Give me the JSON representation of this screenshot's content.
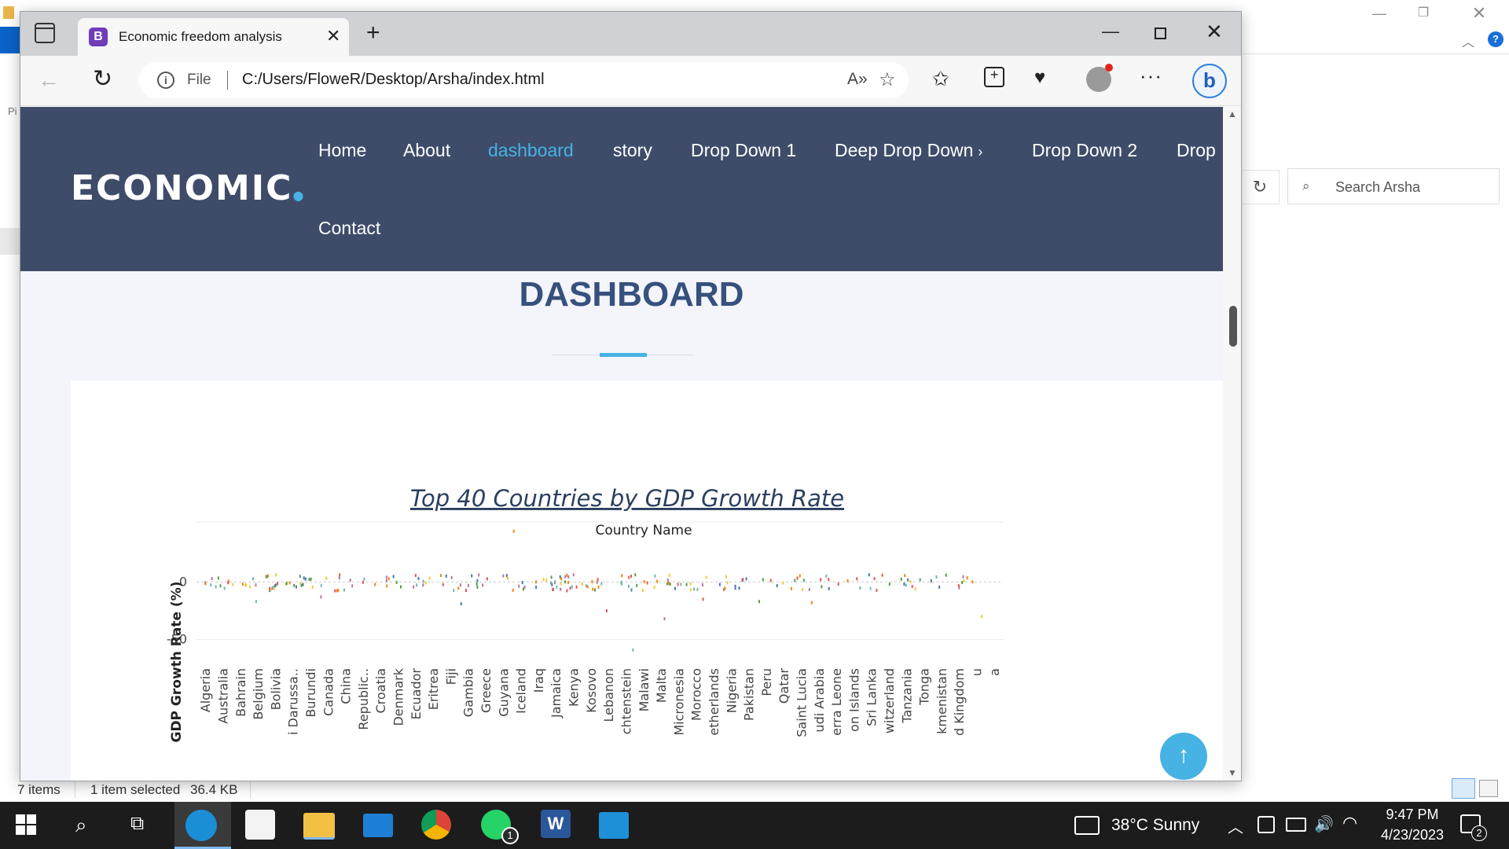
{
  "browser": {
    "tab_title": "Economic freedom analysis",
    "tab_favicon_letter": "B",
    "address_scheme": "File",
    "url": "C:/Users/FloweR/Desktop/Arsha/index.html"
  },
  "site": {
    "logo": "ECONOMIC",
    "nav": [
      {
        "label": "Home"
      },
      {
        "label": "About"
      },
      {
        "label": "dashboard",
        "active": true
      },
      {
        "label": "story"
      },
      {
        "label": "Drop Down 1"
      },
      {
        "label": "Deep Drop Down"
      },
      {
        "label": "Drop Down 2"
      },
      {
        "label": "Drop"
      },
      {
        "label": "Contact"
      }
    ],
    "section_title": "DASHBOARD"
  },
  "chart_data": {
    "type": "scatter",
    "title": "Top 40 Countries by GDP Growth Rate",
    "xlabel": "Country Name",
    "ylabel": "GDP Growth Rate (%)",
    "yticks": [
      "0",
      "-50"
    ],
    "ylim": [
      -68,
      52
    ],
    "grid": true,
    "x_tick_labels": [
      "Algeria",
      "Australia",
      "Bahrain",
      "Belgium",
      "Bolivia",
      "i Darussa..",
      "Burundi",
      "Canada",
      "China",
      "Republic..",
      "Croatia",
      "Denmark",
      "Ecuador",
      "Eritrea",
      "Fiji",
      "Gambia",
      "Greece",
      "Guyana",
      "Iceland",
      "Iraq",
      "Jamaica",
      "Kenya",
      "Kosovo",
      "Lebanon",
      "chtenstein",
      "Malawi",
      "Malta",
      "Micronesia",
      "Morocco",
      "etherlands",
      "Nigeria",
      "Pakistan",
      "Peru",
      "Qatar",
      "Saint Lucia",
      "udi Arabia",
      "erra Leone",
      "on Islands",
      "Sri Lanka",
      "witzerland",
      "Tanzania",
      "Tonga",
      "kmenistan",
      "d Kingdom",
      "u",
      "a"
    ],
    "notable_points": [
      {
        "x_index": 17.6,
        "y": 44
      },
      {
        "x_index": 24.4,
        "y": -59
      },
      {
        "x_index": 26.2,
        "y": -32
      },
      {
        "x_index": 22.9,
        "y": -25
      },
      {
        "x_index": 44.3,
        "y": -30
      },
      {
        "x_index": 14.6,
        "y": -19
      },
      {
        "x_index": 31.6,
        "y": -17
      },
      {
        "x_index": 34.6,
        "y": -18
      },
      {
        "x_index": 2.9,
        "y": -17
      },
      {
        "x_index": 6.6,
        "y": -13
      },
      {
        "x_index": 28.4,
        "y": -15
      }
    ],
    "series_colors": [
      "#f58518",
      "#4c78a8",
      "#e45756",
      "#72b7b2",
      "#54a24b",
      "#eeca3b",
      "#b279a2"
    ]
  },
  "explorer": {
    "search_placeholder": "Search Arsha",
    "status_items": "7 items",
    "status_selected": "1 item selected",
    "status_size": "36.4 KB",
    "left_fragment": "Pi"
  },
  "taskbar": {
    "weather": "38°C  Sunny",
    "time": "9:47 PM",
    "date": "4/23/2023",
    "whatsapp_badge": "1",
    "notifications_badge": "2"
  }
}
